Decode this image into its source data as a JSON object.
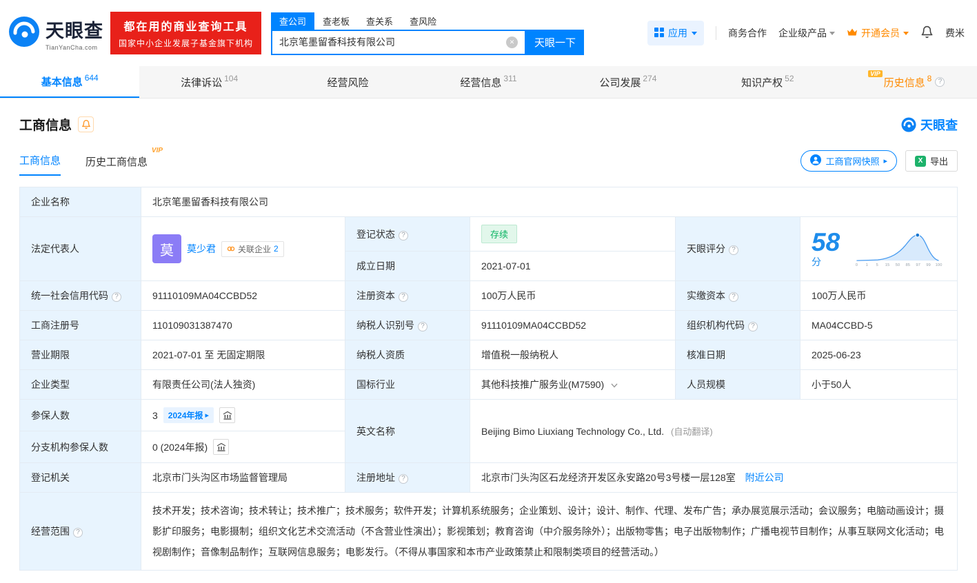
{
  "brand": {
    "name": "天眼查",
    "domain": "TianYanCha.com"
  },
  "promo": {
    "line1": "都在用的商业查询工具",
    "line2": "国家中小企业发展子基金旗下机构"
  },
  "search": {
    "tabs": [
      {
        "label": "查公司"
      },
      {
        "label": "查老板"
      },
      {
        "label": "查关系"
      },
      {
        "label": "查风险"
      }
    ],
    "value": "北京笔墨留香科技有限公司",
    "button": "天眼一下"
  },
  "header_right": {
    "apps": "应用",
    "link1": "商务合作",
    "link2": "企业级产品",
    "vip": "开通会员",
    "user": "费米"
  },
  "nav": {
    "tabs": [
      {
        "label": "基本信息",
        "count": "644"
      },
      {
        "label": "法律诉讼",
        "count": "104"
      },
      {
        "label": "经营风险",
        "count": ""
      },
      {
        "label": "经营信息",
        "count": "311"
      },
      {
        "label": "公司发展",
        "count": "274"
      },
      {
        "label": "知识产权",
        "count": "52"
      },
      {
        "label": "历史信息",
        "count": "8",
        "vip": "VIP"
      }
    ]
  },
  "section": {
    "title": "工商信息",
    "brand": "天眼查",
    "subtab1": "工商信息",
    "subtab2": "历史工商信息",
    "vip": "VIP",
    "snapshot": "工商官网快照",
    "export": "导出"
  },
  "score": {
    "value": "58",
    "unit": "分",
    "axis": [
      "0",
      "1",
      "5",
      "15",
      "50",
      "85",
      "97",
      "99",
      "100"
    ]
  },
  "table": {
    "company_name_label": "企业名称",
    "company_name": "北京笔墨留香科技有限公司",
    "legal_rep_label": "法定代表人",
    "legal_rep_avatar": "莫",
    "legal_rep_name": "莫少君",
    "related_label": "关联企业",
    "related_count": "2",
    "status_label": "登记状态",
    "status": "存续",
    "established_label": "成立日期",
    "established": "2021-07-01",
    "score_label": "天眼评分",
    "credit_code_label": "统一社会信用代码",
    "credit_code": "91110109MA04CCBD52",
    "reg_capital_label": "注册资本",
    "reg_capital": "100万人民币",
    "paid_capital_label": "实缴资本",
    "paid_capital": "100万人民币",
    "reg_number_label": "工商注册号",
    "reg_number": "110109031387470",
    "taxpayer_id_label": "纳税人识别号",
    "taxpayer_id": "91110109MA04CCBD52",
    "org_code_label": "组织机构代码",
    "org_code": "MA04CCBD-5",
    "business_term_label": "营业期限",
    "business_term": "2021-07-01 至 无固定期限",
    "taxpayer_quality_label": "纳税人资质",
    "taxpayer_quality": "增值税一般纳税人",
    "approved_date_label": "核准日期",
    "approved_date": "2025-06-23",
    "company_type_label": "企业类型",
    "company_type": "有限责任公司(法人独资)",
    "industry_label": "国标行业",
    "industry": "其他科技推广服务业(M7590)",
    "staff_size_label": "人员规模",
    "staff_size": "小于50人",
    "insured_label": "参保人数",
    "insured_count": "3",
    "insured_tag": "2024年报",
    "english_name_label": "英文名称",
    "english_name": "Beijing Bimo Liuxiang Technology Co., Ltd.",
    "english_name_note": "(自动翻译)",
    "branch_insured_label": "分支机构参保人数",
    "branch_insured": "0 (2024年报)",
    "registry_label": "登记机关",
    "registry": "北京市门头沟区市场监督管理局",
    "address_label": "注册地址",
    "address": "北京市门头沟区石龙经济开发区永安路20号3号楼一层128室",
    "address_link": "附近公司",
    "scope_label": "经营范围",
    "scope": "技术开发；技术咨询；技术转让；技术推广；技术服务；软件开发；计算机系统服务；企业策划、设计；设计、制作、代理、发布广告；承办展览展示活动；会议服务；电脑动画设计；摄影扩印服务；电影摄制；组织文化艺术交流活动（不含营业性演出）；影视策划；教育咨询（中介服务除外）；出版物零售；电子出版物制作；广播电视节目制作；从事互联网文化活动；电视剧制作；音像制品制作；互联网信息服务；电影发行。（不得从事国家和本市产业政策禁止和限制类项目的经营活动。）"
  }
}
